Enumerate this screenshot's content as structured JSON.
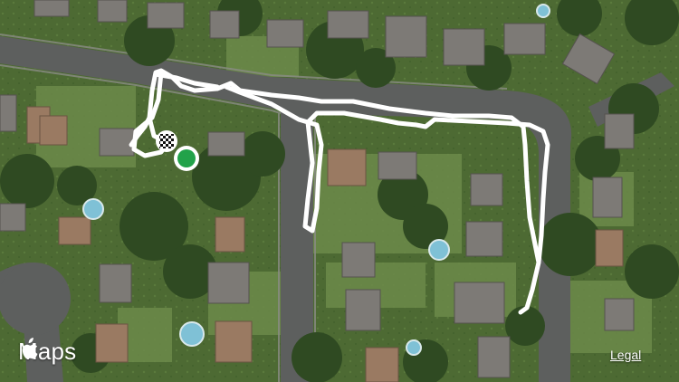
{
  "map": {
    "provider_label": "Maps",
    "legal_label": "Legal",
    "route_color": "#ffffff",
    "start_marker_color": "#22a24a",
    "end_marker_pattern": "checkered-flag",
    "icons": {
      "provider": "apple-logo-icon",
      "finish": "checkered-flag-icon",
      "start": "green-circle-icon"
    }
  }
}
